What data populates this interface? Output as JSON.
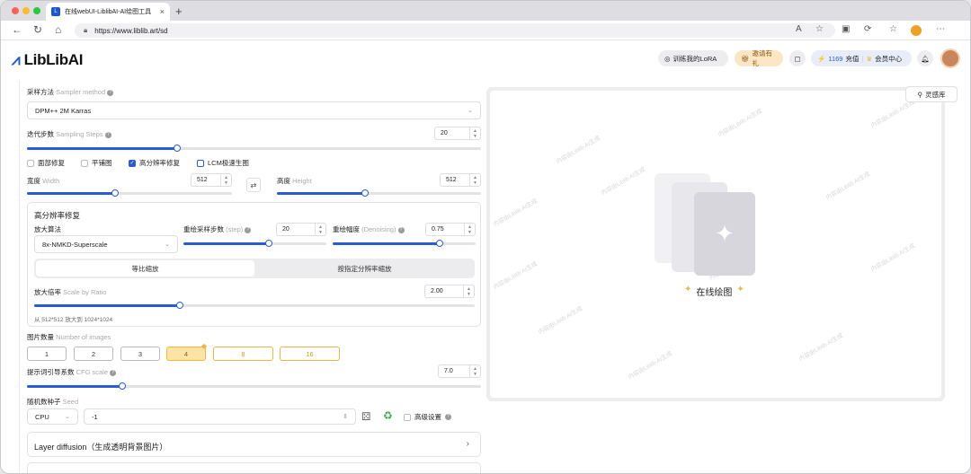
{
  "browser": {
    "tab_title": "在线webUI-LiblibAI-AI绘图工具",
    "url": "https://www.liblib.art/sd"
  },
  "header": {
    "logo_text": "LibLibAI",
    "train_lora": "训练我的LoRA",
    "invite": "邀请有礼",
    "credits": "1169",
    "recharge": "充值",
    "member": "会员中心"
  },
  "sampler": {
    "label": "采样方法",
    "label_en": "Sampler method",
    "value": "DPM++ 2M Karras"
  },
  "steps": {
    "label": "迭代步数",
    "label_en": "Sampling Steps",
    "value": "20",
    "fraction": 0.33
  },
  "options": [
    {
      "label": "面部修复",
      "checked": false
    },
    {
      "label": "平铺图",
      "checked": false
    },
    {
      "label": "高分辨率修复",
      "checked": true
    },
    {
      "label": "LCM极速生图",
      "checked": false
    }
  ],
  "width": {
    "label": "宽度",
    "label_en": "Width",
    "value": "512",
    "fraction": 0.43
  },
  "height": {
    "label": "高度",
    "label_en": "Height",
    "value": "512",
    "fraction": 0.43
  },
  "hires": {
    "title": "高分辨率修复",
    "upscaler_label": "放大算法",
    "upscaler_value": "8x-NMKD-Superscale",
    "steps_label": "重绘采样步数",
    "steps_label_en": "(step)",
    "steps_value": "20",
    "steps_fraction": 0.6,
    "denoise_label": "重绘幅度",
    "denoise_label_en": "(Denoising)",
    "denoise_value": "0.75",
    "denoise_fraction": 0.75,
    "seg_a": "等比缩放",
    "seg_b": "按指定分辨率缩放",
    "scale_label": "放大倍率",
    "scale_label_en": "Scale by Ratio",
    "scale_value": "2.00",
    "scale_fraction": 0.33,
    "note": "从 512*512 放大到 1024*1024"
  },
  "images": {
    "label": "图片数量",
    "label_en": "Number of images",
    "options": [
      "1",
      "2",
      "3",
      "4",
      "8",
      "16"
    ],
    "selected": "4"
  },
  "cfg": {
    "label": "提示词引导系数",
    "label_en": "CFG scale",
    "value": "7.0",
    "fraction": 0.21
  },
  "seed": {
    "label": "随机数种子",
    "label_en": "Seed",
    "device": "CPU",
    "value": "-1",
    "advanced": "高级设置"
  },
  "layer": {
    "label": "Layer diffusion（生成透明背景图片）"
  },
  "canvas": {
    "inspiration": "灵感库",
    "placeholder": "在线绘图",
    "watermark": "内容由Liblib AI生成"
  },
  "colors": {
    "accent": "#2a5bd7",
    "gold": "#f0b53a"
  }
}
